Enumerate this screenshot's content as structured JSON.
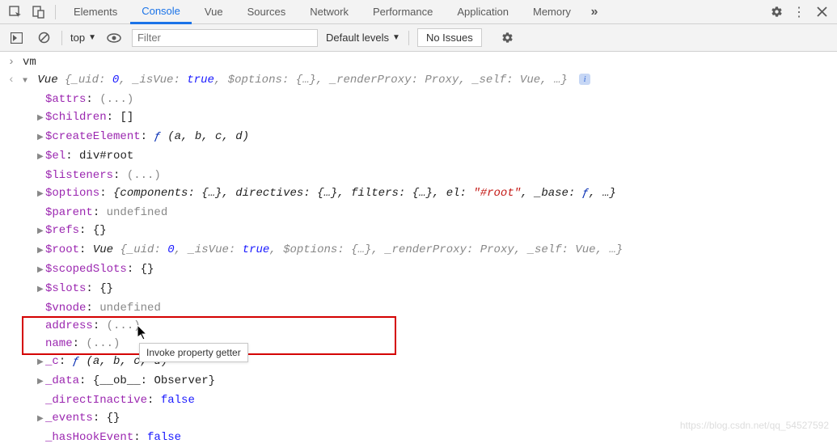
{
  "tabs": {
    "items": [
      "Elements",
      "Console",
      "Vue",
      "Sources",
      "Network",
      "Performance",
      "Application",
      "Memory"
    ],
    "active": "Console"
  },
  "toolbar": {
    "context": "top",
    "filter_placeholder": "Filter",
    "levels": "Default levels",
    "issues": "No Issues"
  },
  "console": {
    "input": "vm",
    "summary_parts": {
      "prefix": "Vue",
      "body1": " {_uid: ",
      "uid": "0",
      "body2": ", _isVue: ",
      "isvue": "true",
      "body3": ", $options: {…}, _renderProxy: Proxy, _self: Vue, …}"
    },
    "props": {
      "attrs": {
        "k": "$attrs",
        "v": "(...)"
      },
      "children": {
        "k": "$children",
        "v": "[]"
      },
      "createElement": {
        "k": "$createElement",
        "f": "ƒ",
        "args": "(a, b, c, d)"
      },
      "el": {
        "k": "$el",
        "v": "div#root"
      },
      "listeners": {
        "k": "$listeners",
        "v": "(...)"
      },
      "options": {
        "k": "$options",
        "parts": [
          "{components: {…}, directives: {…}, filters: {…}, el: ",
          "\"#root\"",
          ", _base: ",
          "ƒ",
          ", …}"
        ]
      },
      "parent": {
        "k": "$parent",
        "v": "undefined"
      },
      "refs": {
        "k": "$refs",
        "v": "{}"
      },
      "root": {
        "k": "$root",
        "prefix": "Vue",
        "body1": " {_uid: ",
        "uid": "0",
        "body2": ", _isVue: ",
        "isvue": "true",
        "body3": ", $options: {…}, _renderProxy: Proxy, _self: Vue, …}"
      },
      "scopedSlots": {
        "k": "$scopedSlots",
        "v": "{}"
      },
      "slots": {
        "k": "$slots",
        "v": "{}"
      },
      "vnode": {
        "k": "$vnode",
        "v": "undefined"
      },
      "address": {
        "k": "address",
        "v": "(...)"
      },
      "name": {
        "k": "name",
        "v": "(...)"
      },
      "c": {
        "k": "_c",
        "f": "ƒ",
        "args": "(a, b, c, d)"
      },
      "data": {
        "k": "_data",
        "v": "{__ob__: Observer}"
      },
      "directInactive": {
        "k": "_directInactive",
        "v": "false"
      },
      "events": {
        "k": "_events",
        "v": "{}"
      },
      "hasHookEvent": {
        "k": "_hasHookEvent",
        "v": "false"
      }
    },
    "tooltip": "Invoke property getter"
  },
  "watermark": "https://blog.csdn.net/qq_54527592"
}
